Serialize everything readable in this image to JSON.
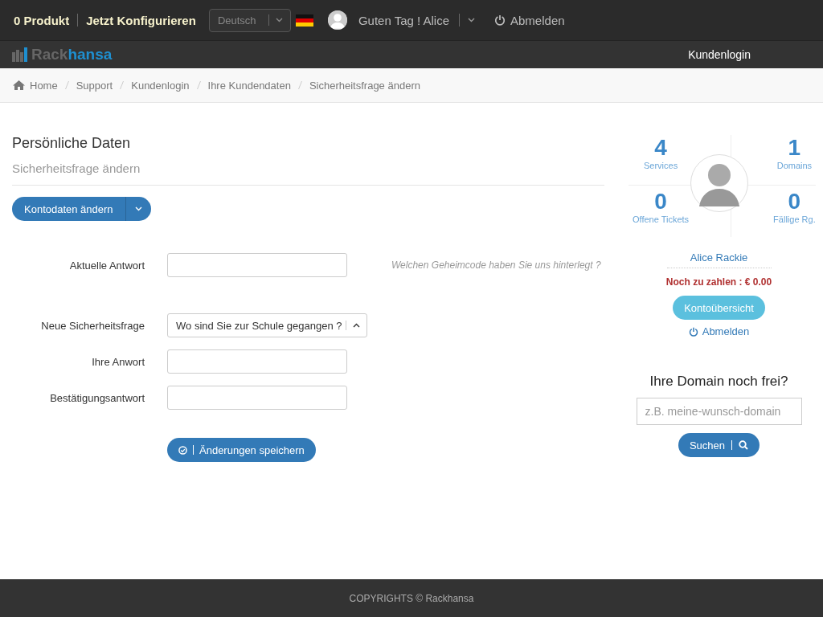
{
  "topbar": {
    "cart": "0 Produkt",
    "configure": "Jetzt Konfigurieren",
    "language": "Deutsch",
    "greeting": "Guten Tag ! Alice",
    "logout": "Abmelden"
  },
  "navbar": {
    "logo": {
      "first": "Rack",
      "second": "hansa"
    },
    "login": "Kundenlogin"
  },
  "breadcrumb": [
    "Home",
    "Support",
    "Kundenlogin",
    "Ihre Kundendaten",
    "Sicherheitsfrage ändern"
  ],
  "page": {
    "title": "Persönliche Daten",
    "subtitle": "Sicherheitsfrage ändern",
    "menu_button": "Kontodaten ändern",
    "form": [
      {
        "kind": "input",
        "label": "Aktuelle Antwort",
        "hint": "Welchen Geheimcode haben Sie uns hinterlegt ?"
      },
      {
        "kind": "select",
        "label": "Neue Sicherheitsfrage",
        "value": "Wo sind Sie zur Schule gegangen ?"
      },
      {
        "kind": "input",
        "label": "Ihre Anwort"
      },
      {
        "kind": "input",
        "label": "Bestätigungsantwort"
      }
    ],
    "save": "Änderungen speichern"
  },
  "sidebar": {
    "stats": [
      {
        "value": "4",
        "label": "Services"
      },
      {
        "value": "1",
        "label": "Domains"
      },
      {
        "value": "0",
        "label": "Offene Tickets"
      },
      {
        "value": "0",
        "label": "Fällige Rg."
      }
    ],
    "name": "Alice Rackie",
    "due": "Noch zu zahlen : € 0.00",
    "overview": "Kontoübersicht",
    "logout": "Abmelden",
    "domain_title": "Ihre Domain noch frei?",
    "domain_placeholder": "z.B. meine-wunsch-domain",
    "search": "Suchen"
  },
  "footer": "COPYRIGHTS © Rackhansa"
}
